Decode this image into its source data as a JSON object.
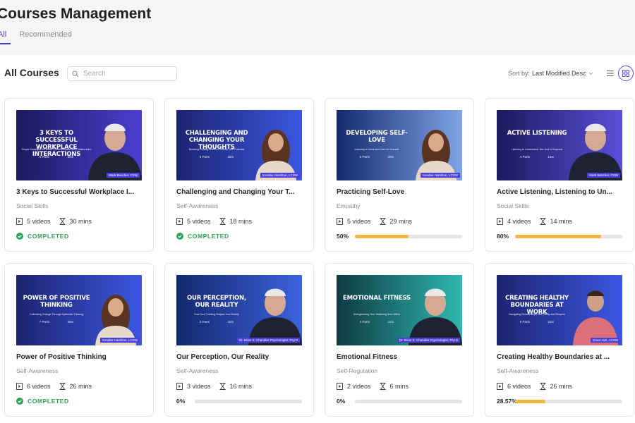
{
  "header": {
    "title": "Courses Management",
    "tabs": [
      {
        "label": "All",
        "active": true
      },
      {
        "label": "Recommended",
        "active": false
      }
    ]
  },
  "toolbar": {
    "section_title": "All Courses",
    "search_placeholder": "Search",
    "sort_label": "Sort by:",
    "sort_value": "Last Modified Desc"
  },
  "colors": {
    "accent": "#4b3fd6",
    "completed": "#2fa45a",
    "progress": "#f3b53f"
  },
  "courses": [
    {
      "title": "3 Keys to Successful Workplace I...",
      "category": "Social Skills",
      "videos": "5 videos",
      "duration": "30 mins",
      "status": "COMPLETED",
      "thumb": {
        "title": "3 KEYS TO SUCCESSFUL WORKPLACE INTERACTIONS",
        "subtitle": "Simple Strategies for Better Communication and Collaboration",
        "parts": "5 Parts",
        "length": "30m",
        "tag": "Mark Bencher, CSW",
        "bg1": "#1a1a5e",
        "bg2": "#4a3fd0",
        "person": "man"
      }
    },
    {
      "title": "Challenging and Changing Your T...",
      "category": "Self-Awareness",
      "videos": "5 videos",
      "duration": "18 mins",
      "status": "COMPLETED",
      "thumb": {
        "title": "CHALLENGING AND CHANGING YOUR THOUGHTS",
        "subtitle": "Breaking Limiting Beliefs to Unlock Your Potential",
        "parts": "5 Parts",
        "length": "18m",
        "tag": "Kendee Hamilton, LCSW",
        "bg1": "#1c2470",
        "bg2": "#3c56e0",
        "person": "woman"
      }
    },
    {
      "title": "Practicing Self-Love",
      "category": "Empathy",
      "videos": "5 videos",
      "duration": "29 mins",
      "progress": 0.5,
      "progress_label": "50%",
      "thumb": {
        "title": "DEVELOPING SELF-LOVE",
        "subtitle": "Learning to Value and Care for Yourself",
        "parts": "5 Parts",
        "length": "29m",
        "tag": "Kendee Hamilton, LCSW",
        "bg1": "#142a6e",
        "bg2": "#7fa4e6",
        "person": "woman"
      }
    },
    {
      "title": "Active Listening, Listening to Un...",
      "category": "Social Skills",
      "videos": "4 videos",
      "duration": "14 mins",
      "progress": 0.8,
      "progress_label": "80%",
      "thumb": {
        "title": "ACTIVE LISTENING",
        "subtitle": "Listening to Understand, Not Just to Respond",
        "parts": "4 Parts",
        "length": "13m",
        "tag": "Mark Bencher, CSW",
        "bg1": "#1a1a5e",
        "bg2": "#5a4fd8",
        "person": "man"
      }
    },
    {
      "title": "Power of Positive Thinking",
      "category": "Self-Awareness",
      "videos": "6 videos",
      "duration": "26 mins",
      "status": "COMPLETED",
      "thumb": {
        "title": "POWER OF POSITIVE THINKING",
        "subtitle": "Cultivating Change Through Optimistic Thinking",
        "parts": "7 Parts",
        "length": "25m",
        "tag": "Kendee Hamilton, LCSW",
        "bg1": "#1c2470",
        "bg2": "#3c56e0",
        "person": "woman"
      }
    },
    {
      "title": "Our Perception, Our Reality",
      "category": "Self-Awareness",
      "videos": "3 videos",
      "duration": "16 mins",
      "progress": 0,
      "progress_label": "0%",
      "thumb": {
        "title": "OUR PERCEPTION, OUR REALITY",
        "subtitle": "How Your Thinking Shapes Your Reality",
        "parts": "3 Parts",
        "length": "16m",
        "tag": "Dr. Brian S. Chandler Psychologist, Psy.D",
        "bg1": "#14286e",
        "bg2": "#3c62dc",
        "person": "man"
      }
    },
    {
      "title": "Emotional Fitness",
      "category": "Self-Regulation",
      "videos": "2 videos",
      "duration": "6 mins",
      "progress": 0,
      "progress_label": "0%",
      "thumb": {
        "title": "EMOTIONAL FITNESS",
        "subtitle": "Strengthening Your Wellbeing from Within",
        "parts": "4 Parts",
        "length": "14m",
        "tag": "Dr. Brian S. Chandler Psychologist, Psy.D",
        "bg1": "#0f3a44",
        "bg2": "#2fb8b0",
        "person": "man"
      }
    },
    {
      "title": "Creating Healthy Boundaries at ...",
      "category": "Self-Awareness",
      "videos": "6 videos",
      "duration": "26 mins",
      "progress": 0.2857,
      "progress_label": "28.57%",
      "thumb": {
        "title": "CREATING HEALTHY BOUNDARIES AT WORK",
        "subtitle": "Navigating Relationships with Clarity and Respect",
        "parts": "6 Parts",
        "length": "24m",
        "tag": "Grant Holt, LCSW",
        "bg1": "#1c2470",
        "bg2": "#3c56e0",
        "person": "young"
      }
    }
  ]
}
